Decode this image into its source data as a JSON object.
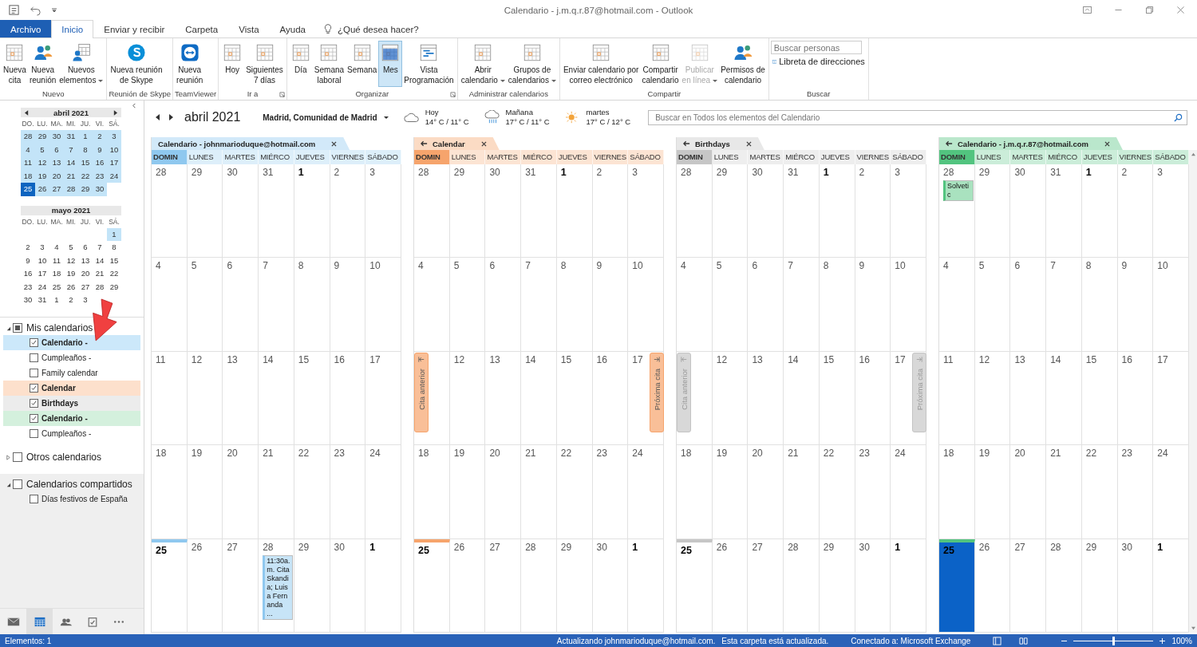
{
  "window": {
    "title": "Calendario - j.m.q.r.87@hotmail.com  -  Outlook"
  },
  "ribbon_tabs": [
    {
      "label": "Archivo",
      "kind": "file",
      "selected": false
    },
    {
      "label": "Inicio",
      "kind": "tab",
      "selected": true
    },
    {
      "label": "Enviar y recibir",
      "kind": "tab",
      "selected": false
    },
    {
      "label": "Carpeta",
      "kind": "tab",
      "selected": false
    },
    {
      "label": "Vista",
      "kind": "tab",
      "selected": false
    },
    {
      "label": "Ayuda",
      "kind": "tab",
      "selected": false
    },
    {
      "label": "¿Qué desea hacer?",
      "kind": "search",
      "selected": false
    }
  ],
  "ribbon": {
    "groups": [
      {
        "label": "Nuevo",
        "launcher": false,
        "buttons": [
          {
            "lines": [
              "Nueva",
              "cita"
            ],
            "dropdown": false,
            "disabled": false,
            "selected": false
          },
          {
            "lines": [
              "Nueva",
              "reunión"
            ],
            "dropdown": false,
            "disabled": false,
            "selected": false
          },
          {
            "lines": [
              "Nuevos",
              "elementos"
            ],
            "dropdown": true,
            "disabled": false,
            "selected": false
          }
        ]
      },
      {
        "label": "Reunión de Skype",
        "launcher": false,
        "buttons": [
          {
            "lines": [
              "Nueva reunión",
              "de Skype"
            ],
            "dropdown": false,
            "disabled": false,
            "selected": false
          }
        ]
      },
      {
        "label": "TeamViewer",
        "launcher": false,
        "buttons": [
          {
            "lines": [
              "Nueva",
              "reunión"
            ],
            "dropdown": false,
            "disabled": false,
            "selected": false
          }
        ]
      },
      {
        "label": "Ir a",
        "launcher": true,
        "buttons": [
          {
            "lines": [
              "Hoy"
            ],
            "dropdown": false,
            "disabled": false,
            "selected": false
          },
          {
            "lines": [
              "Siguientes",
              "7 días"
            ],
            "dropdown": false,
            "disabled": false,
            "selected": false
          }
        ]
      },
      {
        "label": "Organizar",
        "launcher": true,
        "buttons": [
          {
            "lines": [
              "Día"
            ],
            "dropdown": false,
            "disabled": false,
            "selected": false
          },
          {
            "lines": [
              "Semana",
              "laboral"
            ],
            "dropdown": false,
            "disabled": false,
            "selected": false
          },
          {
            "lines": [
              "Semana"
            ],
            "dropdown": false,
            "disabled": false,
            "selected": false
          },
          {
            "lines": [
              "Mes"
            ],
            "dropdown": false,
            "disabled": false,
            "selected": true
          },
          {
            "lines": [
              "Vista",
              "Programación"
            ],
            "dropdown": false,
            "disabled": false,
            "selected": false
          }
        ]
      },
      {
        "label": "Administrar calendarios",
        "launcher": false,
        "buttons": [
          {
            "lines": [
              "Abrir",
              "calendario"
            ],
            "dropdown": true,
            "disabled": false,
            "selected": false
          },
          {
            "lines": [
              "Grupos de",
              "calendarios"
            ],
            "dropdown": true,
            "disabled": false,
            "selected": false
          }
        ]
      },
      {
        "label": "Compartir",
        "launcher": false,
        "buttons": [
          {
            "lines": [
              "Enviar calendario por",
              "correo electrónico"
            ],
            "dropdown": false,
            "disabled": false,
            "selected": false
          },
          {
            "lines": [
              "Compartir",
              "calendario"
            ],
            "dropdown": false,
            "disabled": false,
            "selected": false
          },
          {
            "lines": [
              "Publicar",
              "en línea"
            ],
            "dropdown": true,
            "disabled": true,
            "selected": false
          },
          {
            "lines": [
              "Permisos de",
              "calendario"
            ],
            "dropdown": false,
            "disabled": false,
            "selected": false
          }
        ]
      }
    ],
    "search": {
      "label": "Buscar",
      "placeholder": "Buscar personas",
      "address_book": "Libreta de direcciones"
    }
  },
  "mini_calendars": [
    {
      "title": "abril 2021",
      "nav": true,
      "weekdays": [
        "DO.",
        "LU.",
        "MA.",
        "MI.",
        "JU.",
        "VI.",
        "SÁ."
      ],
      "weeks": [
        {
          "days": [
            {
              "n": "28",
              "in_view": true,
              "today": false
            },
            {
              "n": "29",
              "in_view": true,
              "today": false
            },
            {
              "n": "30",
              "in_view": true,
              "today": false
            },
            {
              "n": "31",
              "in_view": true,
              "today": false
            },
            {
              "n": "1",
              "in_view": true,
              "today": false
            },
            {
              "n": "2",
              "in_view": true,
              "today": false
            },
            {
              "n": "3",
              "in_view": true,
              "today": false
            }
          ]
        },
        {
          "days": [
            {
              "n": "4",
              "in_view": true,
              "today": false
            },
            {
              "n": "5",
              "in_view": true,
              "today": false
            },
            {
              "n": "6",
              "in_view": true,
              "today": false
            },
            {
              "n": "7",
              "in_view": true,
              "today": false
            },
            {
              "n": "8",
              "in_view": true,
              "today": false
            },
            {
              "n": "9",
              "in_view": true,
              "today": false
            },
            {
              "n": "10",
              "in_view": true,
              "today": false
            }
          ]
        },
        {
          "days": [
            {
              "n": "11",
              "in_view": true,
              "today": false
            },
            {
              "n": "12",
              "in_view": true,
              "today": false
            },
            {
              "n": "13",
              "in_view": true,
              "today": false
            },
            {
              "n": "14",
              "in_view": true,
              "today": false
            },
            {
              "n": "15",
              "in_view": true,
              "today": false
            },
            {
              "n": "16",
              "in_view": true,
              "today": false
            },
            {
              "n": "17",
              "in_view": true,
              "today": false
            }
          ]
        },
        {
          "days": [
            {
              "n": "18",
              "in_view": true,
              "today": false
            },
            {
              "n": "19",
              "in_view": true,
              "today": false
            },
            {
              "n": "20",
              "in_view": true,
              "today": false
            },
            {
              "n": "21",
              "in_view": true,
              "today": false
            },
            {
              "n": "22",
              "in_view": true,
              "today": false
            },
            {
              "n": "23",
              "in_view": true,
              "today": false
            },
            {
              "n": "24",
              "in_view": true,
              "today": false
            }
          ]
        },
        {
          "days": [
            {
              "n": "25",
              "in_view": true,
              "today": true
            },
            {
              "n": "26",
              "in_view": true,
              "today": false
            },
            {
              "n": "27",
              "in_view": true,
              "today": false
            },
            {
              "n": "28",
              "in_view": true,
              "today": false
            },
            {
              "n": "29",
              "in_view": true,
              "today": false
            },
            {
              "n": "30",
              "in_view": true,
              "today": false
            }
          ]
        }
      ]
    },
    {
      "title": "mayo 2021",
      "nav": false,
      "weekdays": [
        "DO.",
        "LU.",
        "MA.",
        "MI.",
        "JU.",
        "VI.",
        "SÁ."
      ],
      "weeks": [
        {
          "days": [
            {
              "n": "1",
              "in_view": true,
              "today": false
            }
          ]
        },
        {
          "days": [
            {
              "n": "2",
              "in_view": false,
              "today": false
            },
            {
              "n": "3",
              "in_view": false,
              "today": false
            },
            {
              "n": "4",
              "in_view": false,
              "today": false
            },
            {
              "n": "5",
              "in_view": false,
              "today": false
            },
            {
              "n": "6",
              "in_view": false,
              "today": false
            },
            {
              "n": "7",
              "in_view": false,
              "today": false
            },
            {
              "n": "8",
              "in_view": false,
              "today": false
            }
          ]
        },
        {
          "days": [
            {
              "n": "9",
              "in_view": false,
              "today": false
            },
            {
              "n": "10",
              "in_view": false,
              "today": false
            },
            {
              "n": "11",
              "in_view": false,
              "today": false
            },
            {
              "n": "12",
              "in_view": false,
              "today": false
            },
            {
              "n": "13",
              "in_view": false,
              "today": false
            },
            {
              "n": "14",
              "in_view": false,
              "today": false
            },
            {
              "n": "15",
              "in_view": false,
              "today": false
            }
          ]
        },
        {
          "days": [
            {
              "n": "16",
              "in_view": false,
              "today": false
            },
            {
              "n": "17",
              "in_view": false,
              "today": false
            },
            {
              "n": "18",
              "in_view": false,
              "today": false
            },
            {
              "n": "19",
              "in_view": false,
              "today": false
            },
            {
              "n": "20",
              "in_view": false,
              "today": false
            },
            {
              "n": "21",
              "in_view": false,
              "today": false
            },
            {
              "n": "22",
              "in_view": false,
              "today": false
            }
          ]
        },
        {
          "days": [
            {
              "n": "23",
              "in_view": false,
              "today": false
            },
            {
              "n": "24",
              "in_view": false,
              "today": false
            },
            {
              "n": "25",
              "in_view": false,
              "today": false
            },
            {
              "n": "26",
              "in_view": false,
              "today": false
            },
            {
              "n": "27",
              "in_view": false,
              "today": false
            },
            {
              "n": "28",
              "in_view": false,
              "today": false
            },
            {
              "n": "29",
              "in_view": false,
              "today": false
            }
          ]
        },
        {
          "days": [
            {
              "n": "30",
              "in_view": false,
              "today": false
            },
            {
              "n": "31",
              "in_view": false,
              "today": false
            },
            {
              "n": "1",
              "in_view": false,
              "today": false
            },
            {
              "n": "2",
              "in_view": false,
              "today": false
            },
            {
              "n": "3",
              "in_view": false,
              "today": false
            }
          ]
        }
      ]
    }
  ],
  "calendar_groups": [
    {
      "name": "Mis calendarios",
      "expanded": true,
      "checked": false,
      "indeterminate": true,
      "items": [
        {
          "label": "Calendario -",
          "checked": true,
          "color": "#cce8fa"
        },
        {
          "label": "Cumpleaños -",
          "checked": false
        },
        {
          "label": "Family calendar",
          "checked": false
        },
        {
          "label": "Calendar",
          "checked": true,
          "color": "#fde0cc"
        },
        {
          "label": "Birthdays",
          "checked": true,
          "color": "#ececec"
        },
        {
          "label": "Calendario -",
          "checked": true,
          "color": "#d4f0dd"
        },
        {
          "label": "Cumpleaños -",
          "checked": false
        }
      ]
    },
    {
      "name": "Otros calendarios",
      "expanded": false,
      "checked": false,
      "indeterminate": false
    },
    {
      "name": "Calendarios compartidos",
      "expanded": true,
      "checked": false,
      "indeterminate": false,
      "items": [
        {
          "label": "Días festivos de España",
          "checked": false
        }
      ]
    }
  ],
  "nav_bar": [
    {
      "kind": "mail",
      "selected": false
    },
    {
      "kind": "calendar",
      "selected": true
    },
    {
      "kind": "people",
      "selected": false
    },
    {
      "kind": "tasks",
      "selected": false
    },
    {
      "kind": "more",
      "selected": false
    }
  ],
  "header": {
    "month": "abril 2021",
    "location": "Madrid, Comunidad de Madrid",
    "weather": [
      {
        "day": "Hoy",
        "temp": "14° C / 11° C",
        "kind": "cloudy"
      },
      {
        "day": "Mañana",
        "temp": "17° C / 11° C",
        "kind": "rain"
      },
      {
        "day": "martes",
        "temp": "17° C / 12° C",
        "kind": "sunny"
      }
    ],
    "search_placeholder": "Buscar en Todos los elementos del Calendario"
  },
  "calendars": [
    {
      "title": "Calendario - johnmarioduque@hotmail.com",
      "color": "#8fc8ef",
      "arrow": false,
      "selected": false,
      "weekdays": [
        "DOMIN",
        "LUNES",
        "MARTES",
        "MIÉRCO",
        "JUEVES",
        "VIERNES",
        "SÁBADO"
      ],
      "weeks": [
        [
          {
            "n": "28",
            "bold": false,
            "today": false
          },
          {
            "n": "29",
            "bold": false,
            "today": false
          },
          {
            "n": "30",
            "bold": false,
            "today": false
          },
          {
            "n": "31",
            "bold": false,
            "today": false
          },
          {
            "n": "1",
            "bold": true,
            "today": false
          },
          {
            "n": "2",
            "bold": false,
            "today": false
          },
          {
            "n": "3",
            "bold": false,
            "today": false
          }
        ],
        [
          {
            "n": "4",
            "bold": false,
            "today": false
          },
          {
            "n": "5",
            "bold": false,
            "today": false
          },
          {
            "n": "6",
            "bold": false,
            "today": false
          },
          {
            "n": "7",
            "bold": false,
            "today": false
          },
          {
            "n": "8",
            "bold": false,
            "today": false
          },
          {
            "n": "9",
            "bold": false,
            "today": false
          },
          {
            "n": "10",
            "bold": false,
            "today": false
          }
        ],
        [
          {
            "n": "11",
            "bold": false,
            "today": false
          },
          {
            "n": "12",
            "bold": false,
            "today": false
          },
          {
            "n": "13",
            "bold": false,
            "today": false
          },
          {
            "n": "14",
            "bold": false,
            "today": false
          },
          {
            "n": "15",
            "bold": false,
            "today": false
          },
          {
            "n": "16",
            "bold": false,
            "today": false
          },
          {
            "n": "17",
            "bold": false,
            "today": false
          }
        ],
        [
          {
            "n": "18",
            "bold": false,
            "today": false
          },
          {
            "n": "19",
            "bold": false,
            "today": false
          },
          {
            "n": "20",
            "bold": false,
            "today": false
          },
          {
            "n": "21",
            "bold": false,
            "today": false
          },
          {
            "n": "22",
            "bold": false,
            "today": false
          },
          {
            "n": "23",
            "bold": false,
            "today": false
          },
          {
            "n": "24",
            "bold": false,
            "today": false
          }
        ],
        [
          {
            "n": "25",
            "bold": true,
            "today": true
          },
          {
            "n": "26",
            "bold": false,
            "today": false
          },
          {
            "n": "27",
            "bold": false,
            "today": false
          },
          {
            "n": "28",
            "bold": false,
            "today": false,
            "event": "11:30a. m. Cita Skandia; Luisa Fernanda ..."
          },
          {
            "n": "29",
            "bold": false,
            "today": false
          },
          {
            "n": "30",
            "bold": false,
            "today": false
          },
          {
            "n": "1",
            "bold": true,
            "today": false
          }
        ]
      ]
    },
    {
      "title": "Calendar",
      "color": "#f6a46c",
      "arrow": true,
      "selected": false,
      "weekdays": [
        "DOMIN",
        "LUNES",
        "MARTES",
        "MIÉRCO",
        "JUEVES",
        "VIERNES",
        "SÁBADO"
      ],
      "weeks": [
        [
          {
            "n": "28",
            "bold": false,
            "today": false
          },
          {
            "n": "29",
            "bold": false,
            "today": false
          },
          {
            "n": "30",
            "bold": false,
            "today": false
          },
          {
            "n": "31",
            "bold": false,
            "today": false
          },
          {
            "n": "1",
            "bold": true,
            "today": false
          },
          {
            "n": "2",
            "bold": false,
            "today": false
          },
          {
            "n": "3",
            "bold": false,
            "today": false
          }
        ],
        [
          {
            "n": "4",
            "bold": false,
            "today": false
          },
          {
            "n": "5",
            "bold": false,
            "today": false
          },
          {
            "n": "6",
            "bold": false,
            "today": false
          },
          {
            "n": "7",
            "bold": false,
            "today": false
          },
          {
            "n": "8",
            "bold": false,
            "today": false
          },
          {
            "n": "9",
            "bold": false,
            "today": false
          },
          {
            "n": "10",
            "bold": false,
            "today": false
          }
        ],
        [
          {
            "today": false
          },
          {
            "n": "12",
            "bold": false,
            "today": false
          },
          {
            "n": "13",
            "bold": false,
            "today": false
          },
          {
            "n": "14",
            "bold": false,
            "today": false
          },
          {
            "n": "15",
            "bold": false,
            "today": false
          },
          {
            "n": "16",
            "bold": false,
            "today": false
          },
          {
            "n": "17",
            "bold": false,
            "today": false
          }
        ],
        [
          {
            "n": "18",
            "bold": false,
            "today": false
          },
          {
            "n": "19",
            "bold": false,
            "today": false
          },
          {
            "n": "20",
            "bold": false,
            "today": false
          },
          {
            "n": "21",
            "bold": false,
            "today": false
          },
          {
            "n": "22",
            "bold": false,
            "today": false
          },
          {
            "n": "23",
            "bold": false,
            "today": false
          },
          {
            "n": "24",
            "bold": false,
            "today": false
          }
        ],
        [
          {
            "n": "25",
            "bold": true,
            "today": true
          },
          {
            "n": "26",
            "bold": false,
            "today": false
          },
          {
            "n": "27",
            "bold": false,
            "today": false
          },
          {
            "n": "28",
            "bold": false,
            "today": false
          },
          {
            "n": "29",
            "bold": false,
            "today": false
          },
          {
            "n": "30",
            "bold": false,
            "today": false
          },
          {
            "n": "1",
            "bold": true,
            "today": false
          }
        ]
      ],
      "nav": [
        {
          "label": "Cita anterior",
          "kind": "previous",
          "disabled": false
        },
        {
          "label": "Próxima cita",
          "kind": "next",
          "disabled": false
        }
      ]
    },
    {
      "title": "Birthdays",
      "color": "#c6c6c6",
      "arrow": true,
      "selected": false,
      "weekdays": [
        "DOMIN",
        "LUNES",
        "MARTES",
        "MIÉRCO",
        "JUEVES",
        "VIERNES",
        "SÁBADO"
      ],
      "weeks": [
        [
          {
            "n": "28",
            "bold": false,
            "today": false
          },
          {
            "n": "29",
            "bold": false,
            "today": false
          },
          {
            "n": "30",
            "bold": false,
            "today": false
          },
          {
            "n": "31",
            "bold": false,
            "today": false
          },
          {
            "n": "1",
            "bold": true,
            "today": false
          },
          {
            "n": "2",
            "bold": false,
            "today": false
          },
          {
            "n": "3",
            "bold": false,
            "today": false
          }
        ],
        [
          {
            "n": "4",
            "bold": false,
            "today": false
          },
          {
            "n": "5",
            "bold": false,
            "today": false
          },
          {
            "n": "6",
            "bold": false,
            "today": false
          },
          {
            "n": "7",
            "bold": false,
            "today": false
          },
          {
            "n": "8",
            "bold": false,
            "today": false
          },
          {
            "n": "9",
            "bold": false,
            "today": false
          },
          {
            "n": "10",
            "bold": false,
            "today": false
          }
        ],
        [
          {
            "today": false
          },
          {
            "n": "12",
            "bold": false,
            "today": false
          },
          {
            "n": "13",
            "bold": false,
            "today": false
          },
          {
            "n": "14",
            "bold": false,
            "today": false
          },
          {
            "n": "15",
            "bold": false,
            "today": false
          },
          {
            "n": "16",
            "bold": false,
            "today": false
          },
          {
            "n": "17",
            "bold": false,
            "today": false
          }
        ],
        [
          {
            "n": "18",
            "bold": false,
            "today": false
          },
          {
            "n": "19",
            "bold": false,
            "today": false
          },
          {
            "n": "20",
            "bold": false,
            "today": false
          },
          {
            "n": "21",
            "bold": false,
            "today": false
          },
          {
            "n": "22",
            "bold": false,
            "today": false
          },
          {
            "n": "23",
            "bold": false,
            "today": false
          },
          {
            "n": "24",
            "bold": false,
            "today": false
          }
        ],
        [
          {
            "n": "25",
            "bold": true,
            "today": true
          },
          {
            "n": "26",
            "bold": false,
            "today": false
          },
          {
            "n": "27",
            "bold": false,
            "today": false
          },
          {
            "n": "28",
            "bold": false,
            "today": false
          },
          {
            "n": "29",
            "bold": false,
            "today": false
          },
          {
            "n": "30",
            "bold": false,
            "today": false
          },
          {
            "n": "1",
            "bold": true,
            "today": false
          }
        ]
      ],
      "nav": [
        {
          "label": "Cita anterior",
          "kind": "previous",
          "disabled": true
        },
        {
          "label": "Próxima cita",
          "kind": "next",
          "disabled": true
        }
      ]
    },
    {
      "title": "Calendario - j.m.q.r.87@hotmail.com",
      "color": "#52c47f",
      "arrow": true,
      "selected": true,
      "weekdays": [
        "DOMIN",
        "LUNES",
        "MARTES",
        "MIÉRCO",
        "JUEVES",
        "VIERNES",
        "SÁBADO"
      ],
      "weeks": [
        [
          {
            "n": "28",
            "bold": false,
            "today": false,
            "event": "Solvetic"
          },
          {
            "n": "29",
            "bold": false,
            "today": false
          },
          {
            "n": "30",
            "bold": false,
            "today": false
          },
          {
            "n": "31",
            "bold": false,
            "today": false
          },
          {
            "n": "1",
            "bold": true,
            "today": false
          },
          {
            "n": "2",
            "bold": false,
            "today": false
          },
          {
            "n": "3",
            "bold": false,
            "today": false
          }
        ],
        [
          {
            "n": "4",
            "bold": false,
            "today": false
          },
          {
            "n": "5",
            "bold": false,
            "today": false
          },
          {
            "n": "6",
            "bold": false,
            "today": false
          },
          {
            "n": "7",
            "bold": false,
            "today": false
          },
          {
            "n": "8",
            "bold": false,
            "today": false
          },
          {
            "n": "9",
            "bold": false,
            "today": false
          },
          {
            "n": "10",
            "bold": false,
            "today": false
          }
        ],
        [
          {
            "n": "11",
            "bold": false,
            "today": false
          },
          {
            "n": "12",
            "bold": false,
            "today": false
          },
          {
            "n": "13",
            "bold": false,
            "today": false
          },
          {
            "n": "14",
            "bold": false,
            "today": false
          },
          {
            "n": "15",
            "bold": false,
            "today": false
          },
          {
            "n": "16",
            "bold": false,
            "today": false
          },
          {
            "n": "17",
            "bold": false,
            "today": false
          }
        ],
        [
          {
            "n": "18",
            "bold": false,
            "today": false
          },
          {
            "n": "19",
            "bold": false,
            "today": false
          },
          {
            "n": "20",
            "bold": false,
            "today": false
          },
          {
            "n": "21",
            "bold": false,
            "today": false
          },
          {
            "n": "22",
            "bold": false,
            "today": false
          },
          {
            "n": "23",
            "bold": false,
            "today": false
          },
          {
            "n": "24",
            "bold": false,
            "today": false
          }
        ],
        [
          {
            "n": "25",
            "bold": true,
            "today": true
          },
          {
            "n": "26",
            "bold": false,
            "today": false
          },
          {
            "n": "27",
            "bold": false,
            "today": false
          },
          {
            "n": "28",
            "bold": false,
            "today": false
          },
          {
            "n": "29",
            "bold": false,
            "today": false
          },
          {
            "n": "30",
            "bold": false,
            "today": false
          },
          {
            "n": "1",
            "bold": true,
            "today": false
          }
        ]
      ]
    }
  ],
  "status_bar": {
    "items": "Elementos: 1",
    "sync": "Actualizando johnmarioduque@hotmail.com.",
    "folder": "Esta carpeta está actualizada.",
    "connection": "Conectado a: Microsoft Exchange",
    "zoom": {
      "level": 0.5,
      "reading": "100%"
    }
  }
}
